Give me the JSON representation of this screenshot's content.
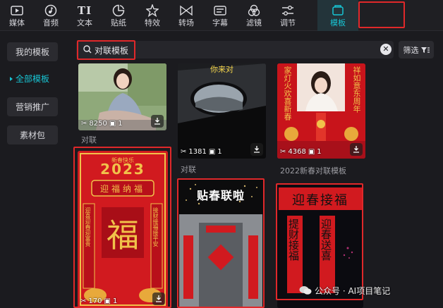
{
  "toolbar": {
    "tabs": [
      {
        "label": "媒体",
        "icon": "media-icon"
      },
      {
        "label": "音频",
        "icon": "audio-icon"
      },
      {
        "label": "文本",
        "icon": "text-icon",
        "glyph": "TI"
      },
      {
        "label": "贴纸",
        "icon": "sticker-icon"
      },
      {
        "label": "特效",
        "icon": "effects-icon"
      },
      {
        "label": "转场",
        "icon": "transition-icon"
      },
      {
        "label": "字幕",
        "icon": "subtitle-icon"
      },
      {
        "label": "滤镜",
        "icon": "filter-icon"
      },
      {
        "label": "调节",
        "icon": "adjust-icon"
      },
      {
        "label": "模板",
        "icon": "template-icon"
      }
    ],
    "active": "模板"
  },
  "sidebar": {
    "items": [
      {
        "label": "我的模板"
      },
      {
        "label": "全部模板"
      },
      {
        "label": "营销推广"
      },
      {
        "label": "素材包"
      }
    ]
  },
  "search": {
    "value": "对联模板",
    "clear_glyph": "✕",
    "filter_label": "筛选"
  },
  "cards": {
    "c1": {
      "uses": "8250",
      "clips": "1",
      "caption": "对联"
    },
    "c2": {
      "overlay_text": "你来对",
      "uses": "1381",
      "clips": "1",
      "caption": "对联"
    },
    "c3": {
      "uses": "4368",
      "clips": "1",
      "caption": "2022新春对联模板",
      "left_couplet": "家灯火欢喜新春",
      "right_couplet": "祥如意东周年"
    },
    "c4": {
      "year": "2023",
      "top_text": "新春快乐",
      "banner": "迎福纳福",
      "fu": "福",
      "left_couplet": "迎喜迎春迎富贵",
      "right_couplet": "接财接福接平安",
      "uses": "170",
      "clips": "1"
    },
    "c5": {
      "headline": "贴春联啦"
    },
    "c6": {
      "headline": "迎春接福",
      "left_couplet": "提财接福",
      "right_couplet": "迎春送喜"
    }
  },
  "watermark": {
    "text": "公众号 · AI项目笔记"
  },
  "colors": {
    "accent": "#18c4d3",
    "highlight_box": "#e0282a",
    "festive_red": "#c8141b",
    "gold": "#f1c24a"
  }
}
